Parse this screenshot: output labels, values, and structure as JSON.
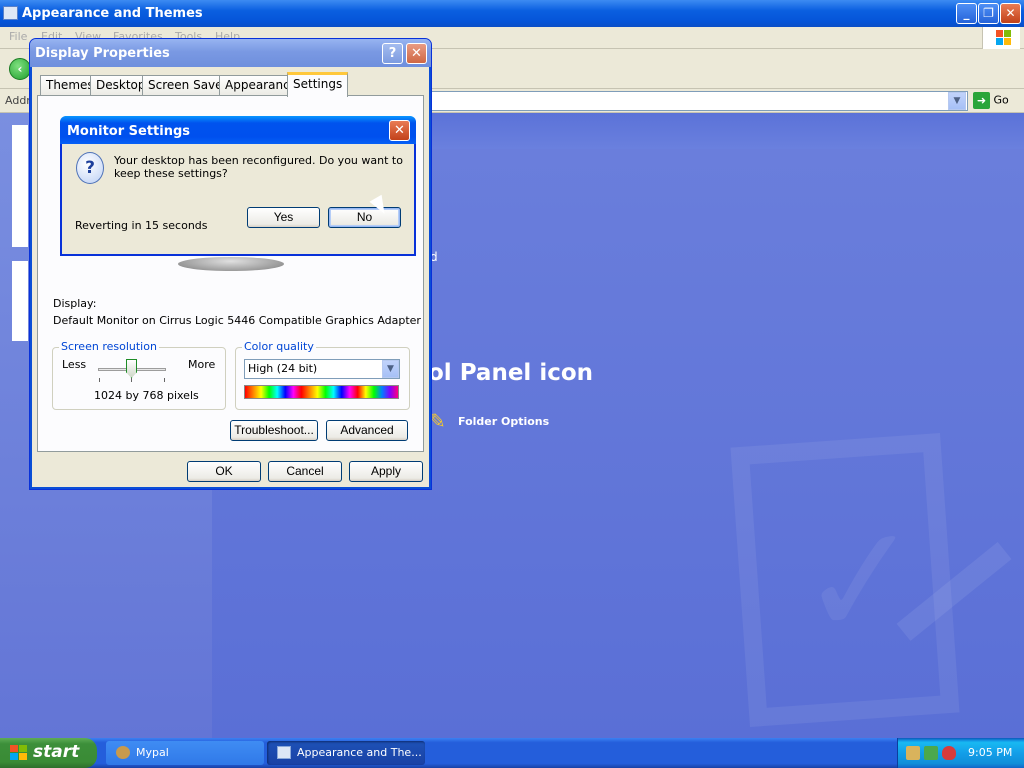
{
  "explorer": {
    "title": "Appearance and Themes",
    "menu": [
      "File",
      "Edit",
      "View",
      "Favorites",
      "Tools",
      "Help"
    ],
    "address_label": "Address",
    "go_label": "Go",
    "heading_fragment": "ol Panel icon",
    "small_fragment": "d",
    "folder_options_label": "Folder Options"
  },
  "display_properties": {
    "title": "Display Properties",
    "help_glyph": "?",
    "close_glyph": "✕",
    "tabs": [
      "Themes",
      "Desktop",
      "Screen Saver",
      "Appearance",
      "Settings"
    ],
    "active_tab": "Settings",
    "display_label": "Display:",
    "display_value": "Default Monitor on Cirrus Logic 5446 Compatible Graphics Adapter",
    "screen_resolution": {
      "legend": "Screen resolution",
      "less_label": "Less",
      "more_label": "More",
      "value": "1024 by 768 pixels"
    },
    "color_quality": {
      "legend": "Color quality",
      "selected": "High (24 bit)"
    },
    "buttons": {
      "troubleshoot": "Troubleshoot...",
      "advanced": "Advanced",
      "ok": "OK",
      "cancel": "Cancel",
      "apply": "Apply"
    }
  },
  "monitor_settings": {
    "title": "Monitor Settings",
    "message": "Your desktop has been reconfigured.  Do you want to keep these settings?",
    "countdown": "Reverting in 15 seconds",
    "yes_label": "Yes",
    "no_label": "No"
  },
  "taskbar": {
    "start_label": "start",
    "tasks": [
      {
        "label": "Mypal",
        "active": false
      },
      {
        "label": "Appearance and The...",
        "active": true
      }
    ],
    "clock": "9:05 PM"
  },
  "colors": {
    "xp_blue_title": "#0053ee",
    "taskbar_blue": "#245edb",
    "start_green": "#3c8f3a",
    "dialog_face": "#ece9d8",
    "group_legend": "#0046d5"
  }
}
